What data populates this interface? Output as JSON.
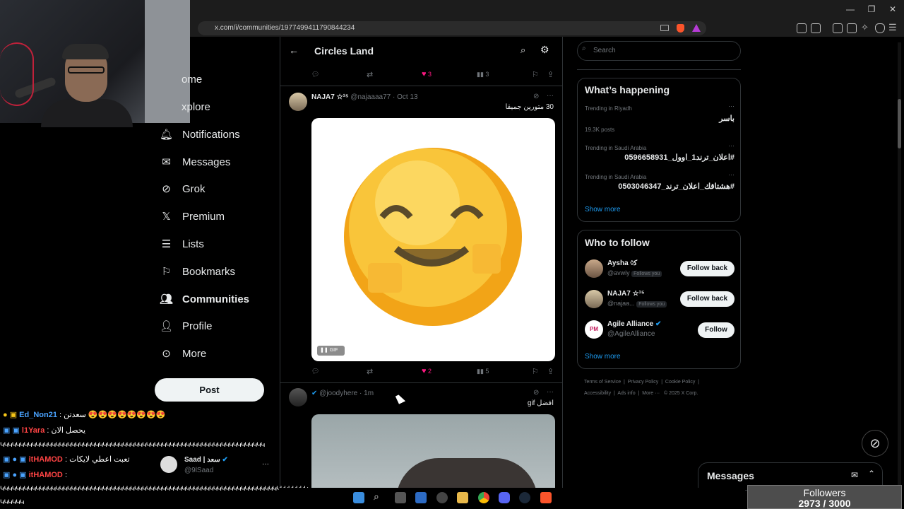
{
  "browser": {
    "url": "x.com/i/communities/1977499411790844234",
    "window_controls": [
      "minimize",
      "restore",
      "close"
    ]
  },
  "nav": {
    "items": [
      {
        "label": "ome",
        "icon": "home-icon"
      },
      {
        "label": "xplore",
        "icon": "explore-icon"
      },
      {
        "label": "Notifications",
        "icon": "bell-icon"
      },
      {
        "label": "Messages",
        "icon": "envelope-icon"
      },
      {
        "label": "Grok",
        "icon": "grok-icon"
      },
      {
        "label": "Premium",
        "icon": "x-logo-icon"
      },
      {
        "label": "Lists",
        "icon": "list-icon"
      },
      {
        "label": "Bookmarks",
        "icon": "bookmark-icon"
      },
      {
        "label": "Communities",
        "icon": "people-icon"
      },
      {
        "label": "Profile",
        "icon": "person-icon"
      },
      {
        "label": "More",
        "icon": "more-circle-icon"
      }
    ],
    "post_label": "Post"
  },
  "feed": {
    "title": "Circles Land",
    "top_actions": {
      "likes": "3",
      "views": "3"
    },
    "post1": {
      "name": "NAJA7 ☆¹⁵",
      "handle": "@najaaaa77",
      "date": "Oct 13",
      "text": "30 متورين جميقا",
      "gif_label": "GIF",
      "likes": "2",
      "views": "5"
    },
    "post2": {
      "handle": "@joodyhere",
      "date": "1m",
      "text": "افضل gif"
    }
  },
  "right": {
    "search_placeholder": "Search",
    "happening": {
      "title": "What’s happening",
      "trends": [
        {
          "meta": "Trending in Riyadh",
          "tag": "باسر",
          "posts": "19.3K posts"
        },
        {
          "meta": "Trending in Saudi Arabia",
          "tag": "#اعلان_ترند1_اوول_0596658931",
          "posts": ""
        },
        {
          "meta": "Trending in Saudi Arabia",
          "tag": "#هشتاقك_اعلان_ترند_0503046347",
          "posts": ""
        }
      ],
      "show_more": "Show more"
    },
    "who": {
      "title": "Who to follow",
      "users": [
        {
          "name": "Aysha ◊ﻛ",
          "handle": "@avwiy",
          "follows_you": "Follows you",
          "button": "Follow back"
        },
        {
          "name": "NAJA7 ☆¹⁵",
          "handle": "@najaa...",
          "follows_you": "Follows you",
          "button": "Follow back"
        },
        {
          "name": "Agile Alliance",
          "handle": "@AgileAlliance",
          "follows_you": "",
          "button": "Follow"
        }
      ],
      "show_more": "Show more"
    },
    "footer": {
      "line1": [
        "Terms of Service",
        "Privacy Policy",
        "Cookie Policy"
      ],
      "line2": [
        "Accessibility",
        "Ads info",
        "More ···",
        "© 2025 X Corp."
      ]
    },
    "messages_label": "Messages"
  },
  "chat": {
    "lines": [
      {
        "name": "Ed_Non21",
        "text": ": سعدتن 😍😍😍😍😍😍😍😍",
        "color": "#4aa3ff"
      },
      {
        "name": "l1Yara",
        "text": ": يحصل الان",
        "color": "#ff4444"
      },
      {
        "name": "itHAMOD",
        "text": ": تعبت اعطي لايكات",
        "color": "#ff4444"
      },
      {
        "name": "itHAMOD",
        "text": ":",
        "color": "#ff4444"
      }
    ],
    "wavy1": "ԿԿԿԿԿԿԿԿԿԿԿԿԿԿԿԿԿԿԿԿԿԿԿԿԿԿԿԿԿԿԿԿԿԿԿԿԿԿԿԿԿԿԿԿԿԿԿԿԿԿԿԿԿԿԿԿԿԿԿԿԿԿԿԿԿԿԿ",
    "wavy2": "ԿԿԿԿԿԿԿԿԿԿԿԿԿԿԿԿԿԿԿԿԿԿԿԿԿԿԿԿԿԿԿԿԿԿԿԿԿԿԿԿԿԿԿԿԿԿԿԿԿԿԿԿԿԿԿԿԿԿԿԿԿԿԿԿԿԿԿԿԿԿԿԿԿԿԿԿԿԿ",
    "wavy3": "ԿԿԿԿԿԿ",
    "account_name": "Saad | سعد",
    "account_handle": "@9lSaad"
  },
  "stream": {
    "followers_label": "Followers",
    "followers_count": "2973 / 3000"
  },
  "colors": {
    "like_pink": "#f91880",
    "blue": "#1d9bf0"
  }
}
